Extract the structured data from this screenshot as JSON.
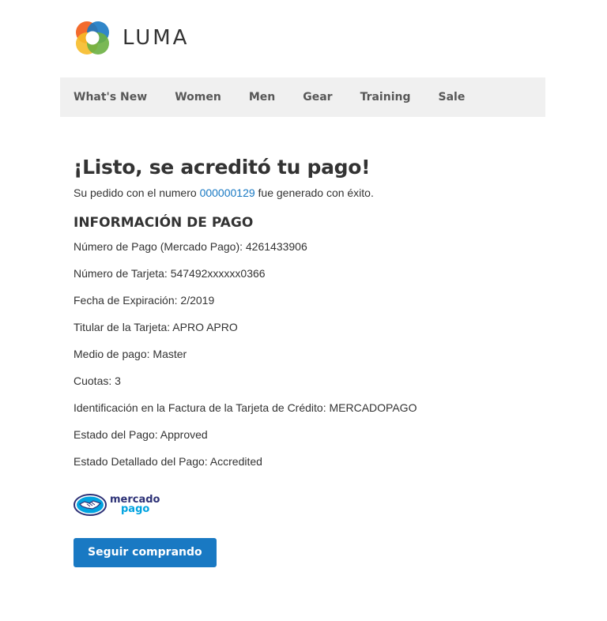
{
  "header": {
    "logo_text": "LUMA"
  },
  "nav": {
    "items": [
      {
        "label": "What's New"
      },
      {
        "label": "Women"
      },
      {
        "label": "Men"
      },
      {
        "label": "Gear"
      },
      {
        "label": "Training"
      },
      {
        "label": "Sale"
      }
    ]
  },
  "main": {
    "title": "¡Listo, se acreditó tu pago!",
    "order_prefix": "Su pedido con el numero",
    "order_number": "000000129",
    "order_suffix": "fue generado con éxito.",
    "section_title": "INFORMACIÓN DE PAGO",
    "payment_info": [
      "Número de Pago (Mercado Pago): 4261433906",
      "Número de Tarjeta: 547492xxxxxx0366",
      "Fecha de Expiración: 2/2019",
      "Titular de la Tarjeta: APRO APRO",
      "Medio de pago: Master",
      "Cuotas: 3",
      "Identificación en la Factura de la Tarjeta de Crédito: MERCADOPAGO",
      "Estado del Pago: Approved",
      "Estado Detallado del Pago: Accredited"
    ],
    "payment_logo": {
      "line1": "mercado",
      "line2": "pago"
    },
    "continue_button": "Seguir comprando"
  },
  "colors": {
    "link": "#1979c3",
    "button_bg": "#1979c3",
    "nav_bg": "#f0f0f0",
    "text": "#333333"
  },
  "icons": {
    "logo": "luma-logo-icon",
    "payment": "mercadopago-handshake-icon"
  }
}
